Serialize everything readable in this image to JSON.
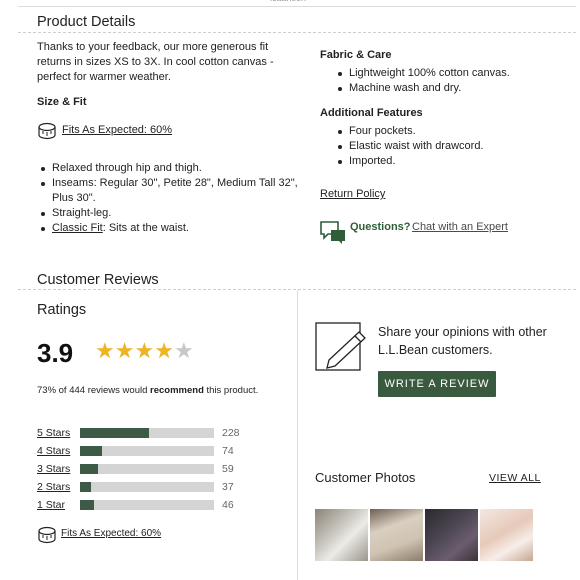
{
  "top_fragment": "lcaantion",
  "details": {
    "title": "Product Details",
    "intro": "Thanks to your feedback, our more generous fit returns in sizes XS to 3X. In cool cotton canvas - perfect for warmer weather.",
    "size_fit_heading": "Size & Fit",
    "fit_link": "Fits As Expected: 60%",
    "size_bullets": [
      "Relaxed through hip and thigh.",
      "Inseams: Regular 30\", Petite 28\", Medium Tall 32\", Plus 30\".",
      "Straight-leg."
    ],
    "classic_fit_link": "Classic Fit",
    "classic_fit_rest": ": Sits at the waist.",
    "fabric_heading": "Fabric & Care",
    "fabric_bullets": [
      "Lightweight 100% cotton canvas.",
      "Machine wash and dry."
    ],
    "features_heading": "Additional Features",
    "features_bullets": [
      "Four pockets.",
      "Elastic waist with drawcord.",
      "Imported."
    ],
    "return_policy": "Return Policy",
    "questions_label": "Questions?",
    "chat_link": "Chat with an Expert"
  },
  "reviews": {
    "title": "Customer Reviews",
    "ratings_title": "Ratings",
    "average": "3.9",
    "average_value": 3.9,
    "star_count": 5,
    "recommend_prefix": "73% of 444 reviews would ",
    "recommend_bold": "recommend",
    "recommend_suffix": " this product.",
    "breakdown": [
      {
        "label": "5 Stars",
        "count": "228",
        "value": 228
      },
      {
        "label": "4 Stars",
        "count": "74",
        "value": 74
      },
      {
        "label": "3 Stars",
        "count": "59",
        "value": 59
      },
      {
        "label": "2 Stars",
        "count": "37",
        "value": 37
      },
      {
        "label": "1 Star",
        "count": "46",
        "value": 46
      }
    ],
    "breakdown_max": 444,
    "fit_link": "Fits As Expected: 60%",
    "share_text": "Share your opinions with other L.L.Bean customers.",
    "write_review_button": "WRITE A REVIEW",
    "photos_title": "Customer Photos",
    "view_all": "VIEW ALL"
  },
  "colors": {
    "accent_green": "#3a5a40",
    "star_gold": "#f0b323",
    "star_empty": "#c8c8c8",
    "link_green": "#2f5d3a"
  }
}
